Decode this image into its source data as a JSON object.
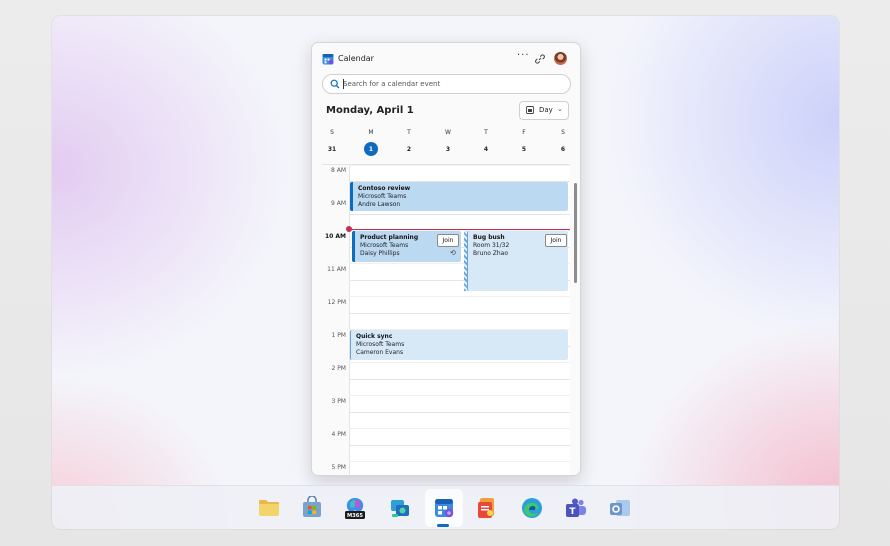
{
  "app": {
    "title": "Calendar",
    "more_label": "···"
  },
  "search": {
    "placeholder": "Search for a calendar event"
  },
  "date_heading": "Monday, April 1",
  "view": {
    "label": "Day",
    "chevron": "⌄"
  },
  "week": {
    "days": [
      {
        "letter": "S",
        "num": "31"
      },
      {
        "letter": "M",
        "num": "1"
      },
      {
        "letter": "T",
        "num": "2"
      },
      {
        "letter": "W",
        "num": "3"
      },
      {
        "letter": "T",
        "num": "4"
      },
      {
        "letter": "F",
        "num": "5"
      },
      {
        "letter": "S",
        "num": "6"
      }
    ],
    "today_index": 1
  },
  "hours": [
    "8 AM",
    "9 AM",
    "10 AM",
    "11 AM",
    "12 PM",
    "1 PM",
    "2 PM",
    "3 PM",
    "4 PM",
    "5 PM"
  ],
  "current_hour_label": "10 AM",
  "events": {
    "contoso": {
      "title": "Contoso review",
      "location": "Microsoft Teams",
      "organizer": "Andre Lawson"
    },
    "product": {
      "title": "Product planning",
      "location": "Microsoft Teams",
      "organizer": "Daisy Phillips",
      "join": "Join"
    },
    "bugbush": {
      "title": "Bug bush",
      "location": "Room 31/32",
      "organizer": "Bruno Zhao",
      "join": "Join"
    },
    "quicksync": {
      "title": "Quick sync",
      "location": "Microsoft Teams",
      "organizer": "Cameron Evans"
    }
  },
  "taskbar": {
    "items": [
      "file-explorer",
      "microsoft-store",
      "m365",
      "dev-home",
      "calendar",
      "office-hub",
      "edge",
      "teams",
      "outlook"
    ],
    "m365_badge": "M365",
    "active": "calendar"
  },
  "colors": {
    "accent": "#0f6cbd",
    "now_line": "#c4314b",
    "event_fill": "#bcd9f2"
  }
}
